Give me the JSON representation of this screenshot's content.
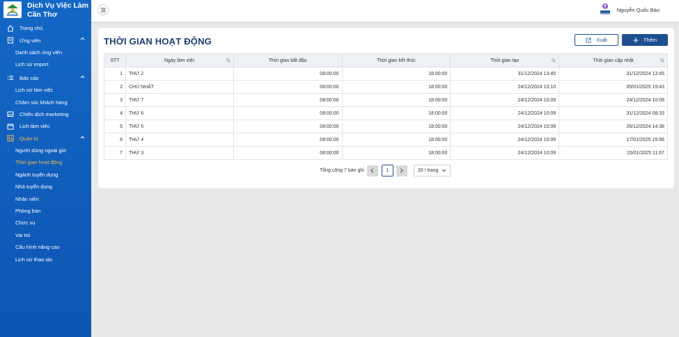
{
  "brand": {
    "title_line1": "Dịch Vụ Việc Làm",
    "title_line2": "Cần Thơ"
  },
  "user": {
    "name": "Nguyễn Quốc Bảo"
  },
  "sidebar": {
    "home": "Trang chủ",
    "candidates": {
      "label": "Ứng viên",
      "items": [
        "Danh sách ứng viên",
        "Lịch sử import"
      ]
    },
    "reports": {
      "label": "Báo cáo",
      "items": [
        "Lịch sử làm việc",
        "Chăm sóc khách hàng"
      ]
    },
    "campaign": "Chiến dịch marketing",
    "schedule": "Lịch làm việc",
    "admin": {
      "label": "Quản trị",
      "items": [
        "Người dùng ngoài giờ",
        "Thời gian hoạt động",
        "Ngành tuyển dụng",
        "Nhà tuyển dụng",
        "Nhân viên",
        "Phòng ban",
        "Chức vụ",
        "Vai trò",
        "Cấu hình nâng cao",
        "Lịch sử thao tác"
      ],
      "active_index": 1
    }
  },
  "page": {
    "title": "THỜI GIAN HOẠT ĐỘNG",
    "export_label": "Xuất",
    "add_label": "Thêm"
  },
  "table": {
    "headers": [
      "STT",
      "Ngày làm việc",
      "Thời gian bắt đầu",
      "Thời gian kết thúc",
      "Thời gian tạo",
      "Thời gian cập nhật"
    ],
    "rows": [
      [
        "1",
        "THỨ 2",
        "08:00:00",
        "18:00:00",
        "31/12/2024 13:45",
        "31/12/2024 13:45"
      ],
      [
        "2",
        "CHỦ NHẬT",
        "08:00:00",
        "18:00:00",
        "24/12/2024 10:10",
        "05/01/2025 19:43"
      ],
      [
        "3",
        "THỨ 7",
        "08:00:00",
        "18:00:00",
        "24/12/2024 10:09",
        "24/12/2024 10:09"
      ],
      [
        "4",
        "THỨ 6",
        "08:00:00",
        "18:00:00",
        "24/12/2024 10:09",
        "31/12/2024 08:33"
      ],
      [
        "5",
        "THỨ 5",
        "08:00:00",
        "18:00:00",
        "24/12/2024 10:09",
        "26/12/2024 14:38"
      ],
      [
        "6",
        "THỨ 4",
        "08:00:00",
        "18:00:00",
        "24/12/2024 10:09",
        "17/01/2025 15:56"
      ],
      [
        "7",
        "THỨ 3",
        "08:00:00",
        "18:00:00",
        "24/12/2024 10:09",
        "15/01/2025 11:07"
      ]
    ]
  },
  "pagination": {
    "total_text": "Tổng cộng 7 bản ghi",
    "current_page": "1",
    "page_size": "20 / trang"
  },
  "colors": {
    "sidebar": "#0d56b3",
    "primary": "#1d4f91",
    "active_menu": "#f2b84b",
    "title": "#1a3f70"
  }
}
